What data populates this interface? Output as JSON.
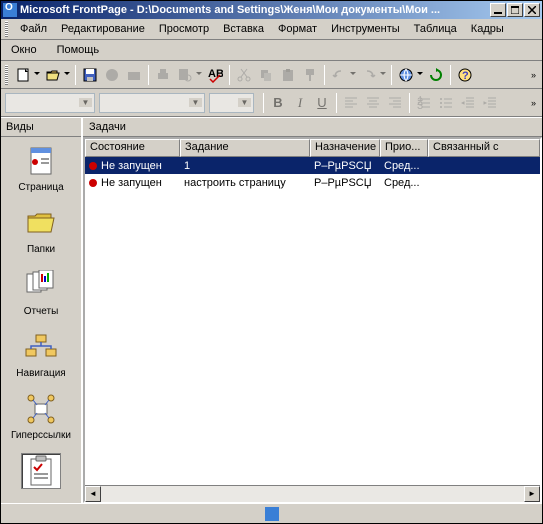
{
  "title": "Microsoft FrontPage - D:\\Documents and Settings\\Женя\\Мои документы\\Мои ...",
  "menu": {
    "file": "Файл",
    "edit": "Редактирование",
    "view": "Просмотр",
    "insert": "Вставка",
    "format": "Формат",
    "tools": "Инструменты",
    "table": "Таблица",
    "frames": "Кадры",
    "window": "Окно",
    "help": "Помощь"
  },
  "views": {
    "header": "Виды",
    "page": "Страница",
    "folders": "Папки",
    "reports": "Отчеты",
    "navigation": "Навигация",
    "hyperlinks": "Гиперссылки",
    "tasks": "Задачи"
  },
  "main": {
    "header": "Задачи",
    "columns": {
      "status": "Состояние",
      "task": "Задание",
      "assigned": "Назначение",
      "priority": "Прио...",
      "linked": "Связанный с"
    },
    "rows": [
      {
        "status": "Не запущен",
        "task": "1",
        "assigned": "Р–РµРЅСЏ",
        "priority": "Сред...",
        "linked": ""
      },
      {
        "status": "Не запущен",
        "task": "настроить страницу",
        "assigned": "Р–РµРЅСЏ",
        "priority": "Сред...",
        "linked": ""
      }
    ]
  },
  "fmt": {
    "bold": "B",
    "italic": "I",
    "underline": "U"
  },
  "colwidths": {
    "status": 95,
    "task": 130,
    "assigned": 70,
    "priority": 48,
    "linked": 100
  }
}
